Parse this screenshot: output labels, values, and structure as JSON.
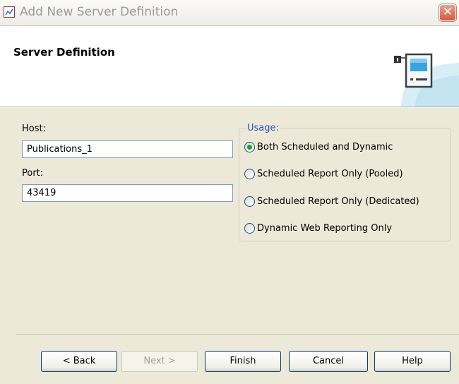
{
  "window": {
    "title": "Add New Server Definition",
    "close_glyph": "✕",
    "app_icon": "chart-icon"
  },
  "header": {
    "section_title": "Server Definition",
    "graphic_icon": "server-icon"
  },
  "form": {
    "host_label": "Host:",
    "host_value": "Publications_1",
    "port_label": "Port:",
    "port_value": "43419"
  },
  "usage": {
    "legend": "Usage:",
    "options": [
      {
        "label": "Both Scheduled and Dynamic",
        "selected": true
      },
      {
        "label": "Scheduled Report Only (Pooled)",
        "selected": false
      },
      {
        "label": "Scheduled Report Only (Dedicated)",
        "selected": false
      },
      {
        "label": "Dynamic Web Reporting Only",
        "selected": false
      }
    ],
    "selected_color": "#21a121"
  },
  "buttons": {
    "back": "< Back",
    "next": "Next >",
    "finish": "Finish",
    "cancel": "Cancel",
    "help": "Help"
  },
  "colors": {
    "dialog_background": "#ece9d8",
    "legend_text": "#2b4fbd",
    "close_button": "#d25b42"
  }
}
